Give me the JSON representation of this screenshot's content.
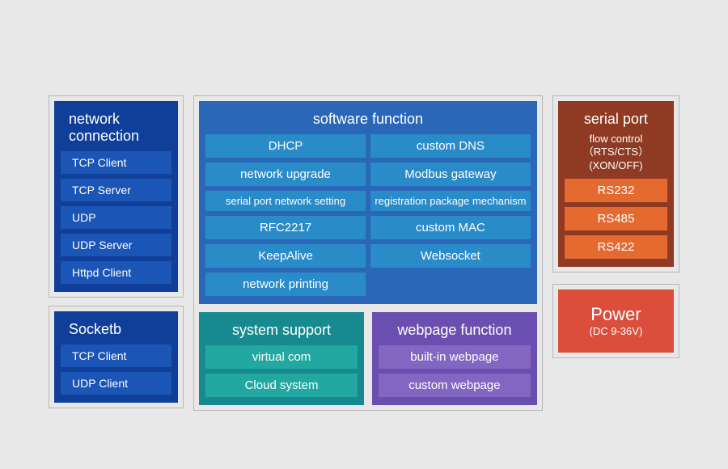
{
  "network": {
    "title": "network connection",
    "items": [
      "TCP Client",
      "TCP Server",
      "UDP",
      "UDP Server",
      "Httpd Client"
    ]
  },
  "socketb": {
    "title": "Socketb",
    "items": [
      "TCP Client",
      "UDP Client"
    ]
  },
  "software": {
    "title": "software function",
    "left": [
      "DHCP",
      "network upgrade",
      "serial port network setting",
      "RFC2217",
      "KeepAlive",
      "network printing"
    ],
    "right": [
      "custom DNS",
      "Modbus gateway",
      "registration package mechanism",
      "custom MAC",
      "Websocket"
    ]
  },
  "system": {
    "title": "system support",
    "items": [
      "virtual com",
      "Cloud system"
    ]
  },
  "webpage": {
    "title": "webpage function",
    "items": [
      "built-in webpage",
      "custom webpage"
    ]
  },
  "serial": {
    "title": "serial port",
    "subtitle": "flow control（RTS/CTS）(XON/OFF)",
    "items": [
      "RS232",
      "RS485",
      "RS422"
    ]
  },
  "power": {
    "title": "Power",
    "subtitle": "(DC 9-36V)"
  }
}
